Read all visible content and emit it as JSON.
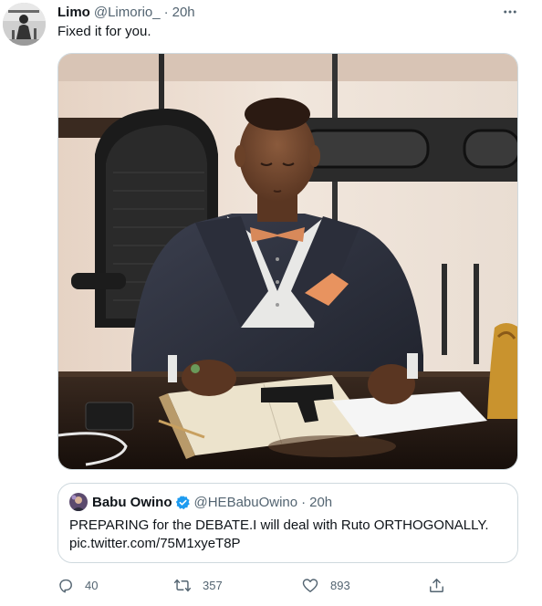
{
  "author": {
    "name": "Limo",
    "handle": "@Limorio_",
    "separator": "·",
    "time": "20h",
    "avatar_icon": "user-avatar"
  },
  "tweet": {
    "text": "Fixed it for you.",
    "media_description_icon": "photo"
  },
  "quote": {
    "name": "Babu Owino",
    "verified": true,
    "handle": "@HEBabuOwino",
    "separator": "·",
    "time": "20h",
    "text_line1": "PREPARING for the DEBATE.I will deal with Ruto ORTHOGONALLY.",
    "text_line2": "pic.twitter.com/75M1xyeT8P"
  },
  "actions": {
    "replies": "40",
    "retweets": "357",
    "likes": "893"
  },
  "colors": {
    "text_primary": "#0f1419",
    "text_secondary": "#536471",
    "border": "#cfd9de",
    "verified_blue": "#1d9bf0"
  }
}
